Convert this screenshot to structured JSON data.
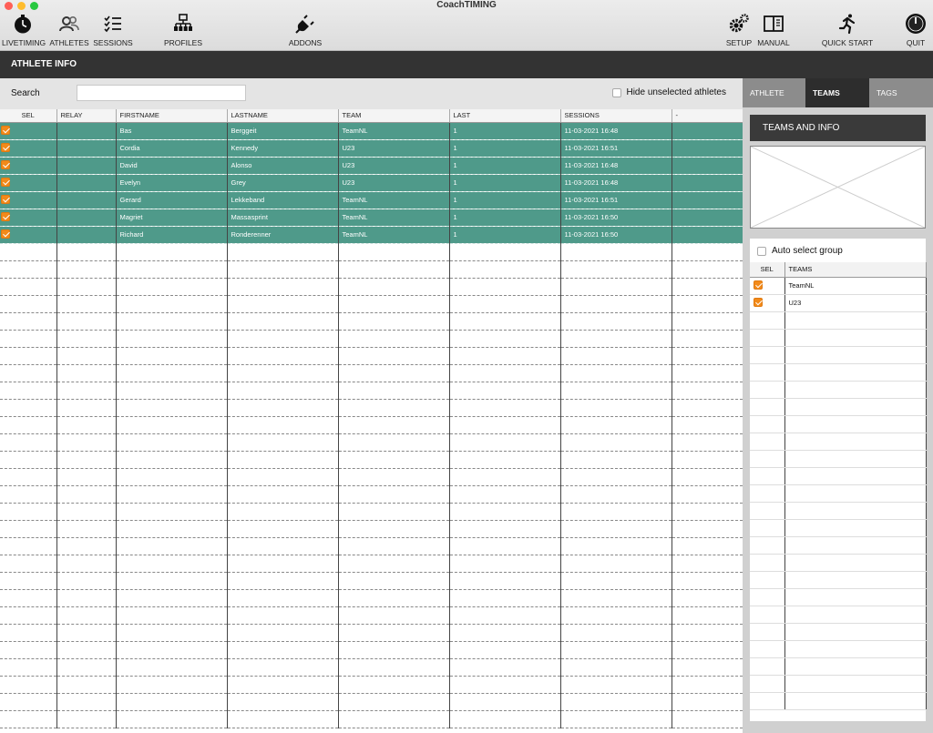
{
  "window": {
    "title": "CoachTIMING"
  },
  "toolbar": {
    "livetiming": "LIVETIMING",
    "athletes": "ATHLETES",
    "sessions": "SESSIONS",
    "profiles": "PROFILES",
    "addons": "ADDONS",
    "setup": "SETUP",
    "manual": "MANUAL",
    "quick_start": "QUICK START",
    "quit": "QUIT"
  },
  "section": {
    "title": "ATHLETE INFO"
  },
  "search": {
    "label": "Search",
    "value": "",
    "placeholder": ""
  },
  "hide_unselected": {
    "label": "Hide unselected athletes",
    "checked": false
  },
  "athlete_table": {
    "columns": [
      "SEL",
      "RELAY",
      "FIRSTNAME",
      "LASTNAME",
      "TEAM",
      "LAST",
      "SESSIONS",
      "-"
    ],
    "rows": [
      {
        "sel": true,
        "relay": "",
        "first": "Bas",
        "last": "Berggeit",
        "team": "TeamNL",
        "lastval": "1",
        "sessions": "11-03-2021 16:48",
        "extra": ""
      },
      {
        "sel": true,
        "relay": "",
        "first": "Cordia",
        "last": "Kennedy",
        "team": "U23",
        "lastval": "1",
        "sessions": "11-03-2021 16:51",
        "extra": ""
      },
      {
        "sel": true,
        "relay": "",
        "first": "David",
        "last": "Alonso",
        "team": "U23",
        "lastval": "1",
        "sessions": "11-03-2021 16:48",
        "extra": ""
      },
      {
        "sel": true,
        "relay": "",
        "first": "Evelyn",
        "last": "Grey",
        "team": "U23",
        "lastval": "1",
        "sessions": "11-03-2021 16:48",
        "extra": ""
      },
      {
        "sel": true,
        "relay": "",
        "first": "Gerard",
        "last": "Lekkeband",
        "team": "TeamNL",
        "lastval": "1",
        "sessions": "11-03-2021 16:51",
        "extra": ""
      },
      {
        "sel": true,
        "relay": "",
        "first": "Magriet",
        "last": "Massasprint",
        "team": "TeamNL",
        "lastval": "1",
        "sessions": "11-03-2021 16:50",
        "extra": ""
      },
      {
        "sel": true,
        "relay": "",
        "first": "Richard",
        "last": "Ronderenner",
        "team": "TeamNL",
        "lastval": "1",
        "sessions": "11-03-2021 16:50",
        "extra": ""
      }
    ]
  },
  "right_tabs": {
    "athlete": "ATHLETE",
    "teams": "TEAMS",
    "tags": "TAGS",
    "active": "TEAMS"
  },
  "teams_panel": {
    "header": "TEAMS AND INFO",
    "auto_select": {
      "label": "Auto select group",
      "checked": false
    },
    "columns": [
      "SEL",
      "TEAMS"
    ],
    "rows": [
      {
        "sel": true,
        "team": "TeamNL"
      },
      {
        "sel": true,
        "team": "U23"
      }
    ]
  },
  "colors": {
    "selected_row": "#4f9a8a",
    "checkbox_checked": "#f28a1a",
    "header_dark": "#333333",
    "tab_active": "#2d2d2d",
    "tab_inactive": "#8c8c8c"
  }
}
